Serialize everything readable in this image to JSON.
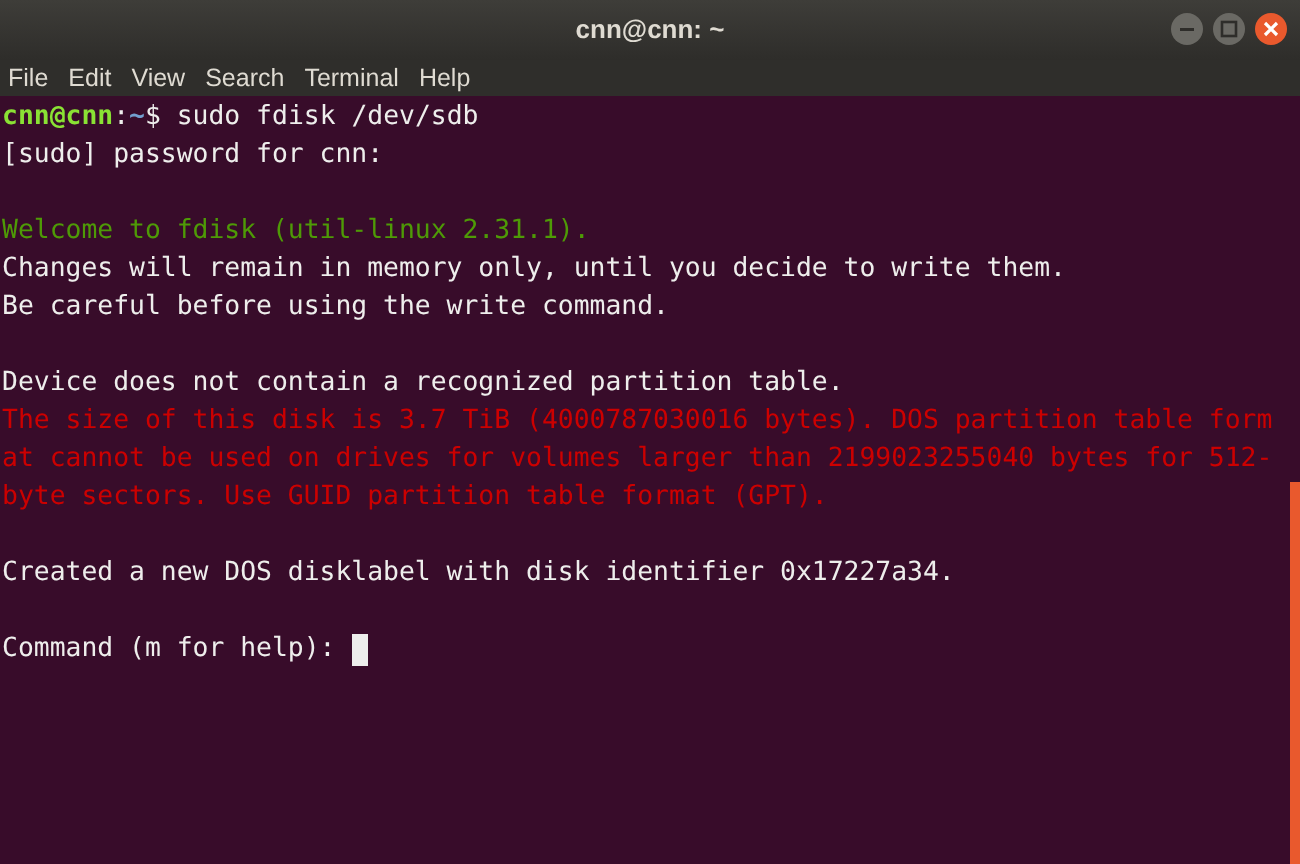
{
  "window": {
    "title": "cnn@cnn: ~"
  },
  "menu": [
    "File",
    "Edit",
    "View",
    "Search",
    "Terminal",
    "Help"
  ],
  "terminal": {
    "lines": [
      {
        "kind": "prompt",
        "user_host": "cnn@cnn",
        "separator": ":",
        "path": "~",
        "command": "$ sudo fdisk /dev/sdb"
      },
      {
        "kind": "normal",
        "text": "[sudo] password for cnn:"
      },
      {
        "kind": "blank"
      },
      {
        "kind": "green",
        "text": "Welcome to fdisk (util-linux 2.31.1)."
      },
      {
        "kind": "normal",
        "text": "Changes will remain in memory only, until you decide to write them."
      },
      {
        "kind": "normal",
        "text": "Be careful before using the write command."
      },
      {
        "kind": "blank"
      },
      {
        "kind": "normal",
        "text": "Device does not contain a recognized partition table."
      },
      {
        "kind": "red",
        "text": "The size of this disk is 3.7 TiB (4000787030016 bytes). DOS partition table form"
      },
      {
        "kind": "red",
        "text": "at cannot be used on drives for volumes larger than 2199023255040 bytes for 512-"
      },
      {
        "kind": "red",
        "text": "byte sectors. Use GUID partition table format (GPT)."
      },
      {
        "kind": "blank"
      },
      {
        "kind": "normal",
        "text": "Created a new DOS disklabel with disk identifier 0x17227a34."
      },
      {
        "kind": "blank"
      },
      {
        "kind": "input",
        "text": "Command (m for help):",
        "cursor": true
      }
    ]
  }
}
